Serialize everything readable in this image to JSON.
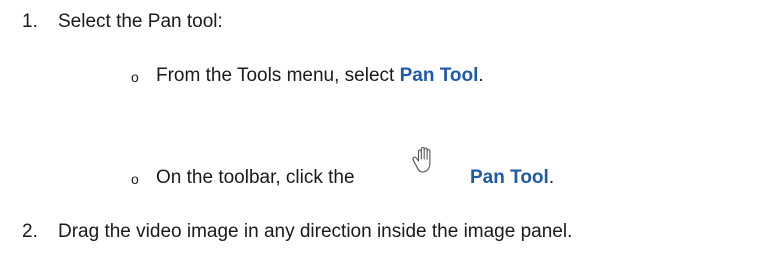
{
  "steps": [
    {
      "number": "1.",
      "text": "Select the Pan tool:",
      "substeps": [
        {
          "bullet": "o",
          "text_before": "From the Tools menu, select ",
          "term": "Pan Tool",
          "text_after": "."
        },
        {
          "bullet": "o",
          "text_before": "On the toolbar, click the",
          "icon": "pan-hand-icon",
          "term": "Pan Tool",
          "text_after": "."
        }
      ]
    },
    {
      "number": "2.",
      "text": "Drag the video image in any direction inside the image panel."
    }
  ],
  "colors": {
    "ui_term": "#1f5aa8",
    "text": "#1a1a1a"
  }
}
